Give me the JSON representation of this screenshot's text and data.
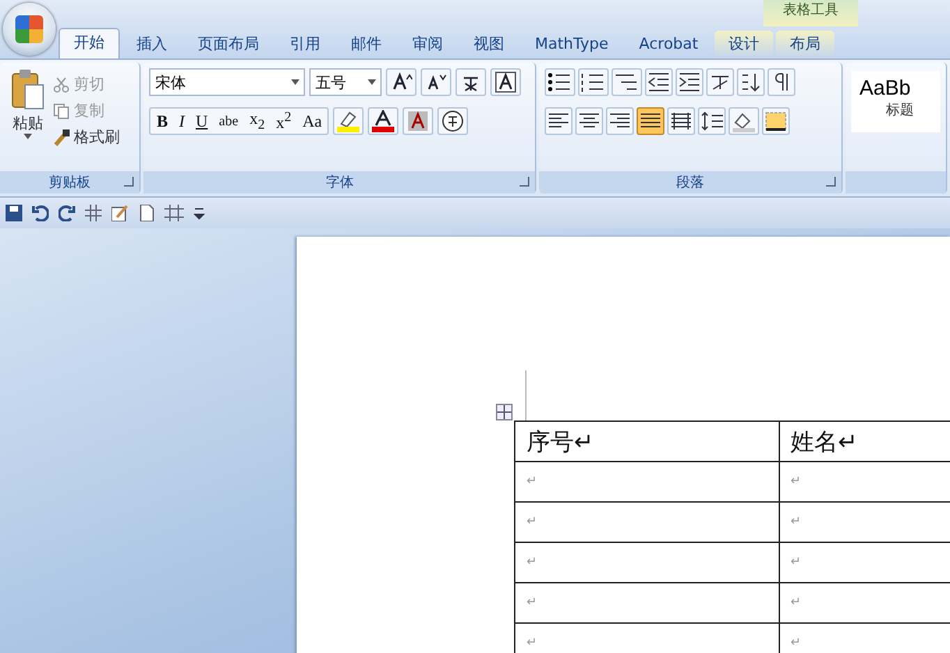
{
  "tabs": [
    {
      "label": "开始",
      "selected": true
    },
    {
      "label": "插入",
      "selected": false
    },
    {
      "label": "页面布局",
      "selected": false
    },
    {
      "label": "引用",
      "selected": false
    },
    {
      "label": "邮件",
      "selected": false
    },
    {
      "label": "审阅",
      "selected": false
    },
    {
      "label": "视图",
      "selected": false
    },
    {
      "label": "MathType",
      "selected": false
    },
    {
      "label": "Acrobat",
      "selected": false
    }
  ],
  "contextual_tabs": {
    "title": "表格工具",
    "tabs": [
      {
        "label": "设计",
        "selected": false
      },
      {
        "label": "布局",
        "selected": false
      }
    ]
  },
  "clipboard": {
    "paste": "粘贴",
    "cut": "剪切",
    "copy": "复制",
    "format_painter": "格式刷",
    "label": "剪贴板"
  },
  "font": {
    "font_name": "宋体",
    "font_size": "五号",
    "format_buttons": [
      "B",
      "I",
      "U",
      "abe",
      "x$_{2}$",
      "x$^{2}$",
      "Aa"
    ],
    "label": "字体"
  },
  "paragraph": {
    "label": "段落"
  },
  "styles": {
    "preview": "AaBb",
    "name": "标题"
  },
  "table": {
    "rows": [
      [
        "序号↵",
        "姓名↵"
      ],
      [
        "↵",
        "↵"
      ],
      [
        "↵",
        "↵"
      ],
      [
        "↵",
        "↵"
      ],
      [
        "↵",
        "↵"
      ],
      [
        "↵",
        "↵"
      ]
    ]
  }
}
